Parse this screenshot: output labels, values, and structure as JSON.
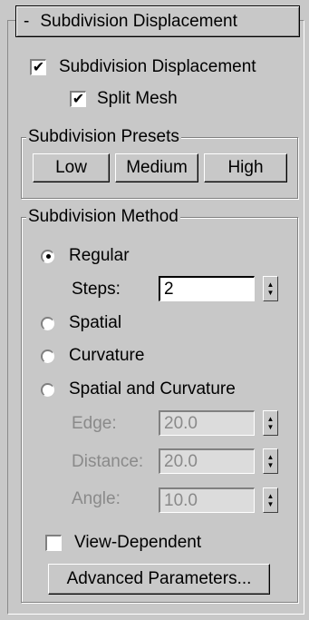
{
  "rollout": {
    "toggle": "-",
    "title": "Subdivision Displacement"
  },
  "options": {
    "subdivision_displacement": {
      "label": "Subdivision Displacement",
      "checked": true
    },
    "split_mesh": {
      "label": "Split Mesh",
      "checked": true
    }
  },
  "presets": {
    "title": "Subdivision Presets",
    "low": "Low",
    "medium": "Medium",
    "high": "High"
  },
  "method": {
    "title": "Subdivision Method",
    "regular": {
      "label": "Regular",
      "selected": true
    },
    "steps": {
      "label": "Steps:",
      "value": "2"
    },
    "spatial": {
      "label": "Spatial",
      "selected": false
    },
    "curvature": {
      "label": "Curvature",
      "selected": false
    },
    "spatial_and_curvature": {
      "label": "Spatial and Curvature",
      "selected": false
    },
    "edge": {
      "label": "Edge:",
      "value": "20.0"
    },
    "distance": {
      "label": "Distance:",
      "value": "20.0"
    },
    "angle": {
      "label": "Angle:",
      "value": "10.0"
    },
    "view_dependent": {
      "label": "View-Dependent",
      "checked": false
    },
    "advanced_button": "Advanced Parameters..."
  },
  "glyphs": {
    "check": "✔",
    "spin_up": "▲",
    "spin_down": "▼"
  }
}
